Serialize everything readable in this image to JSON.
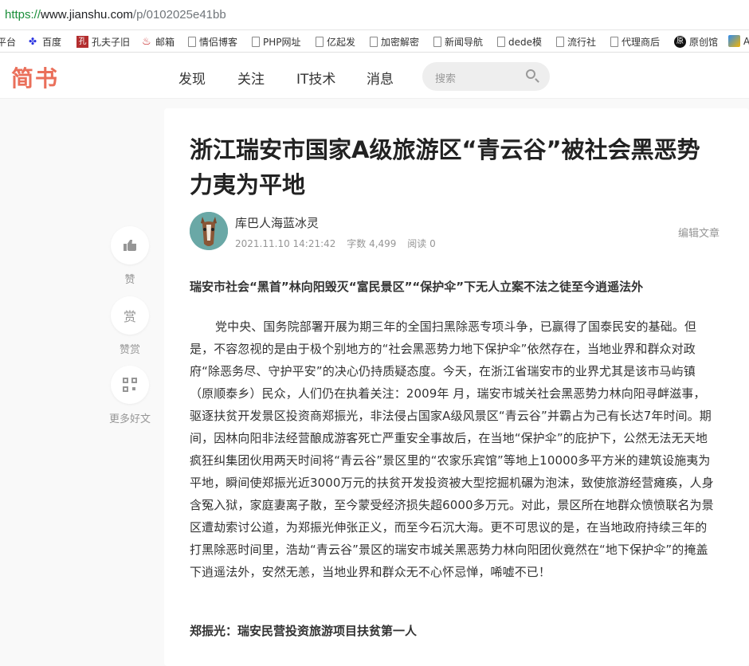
{
  "browser": {
    "url_scheme": "https://",
    "url_host": "www.jianshu.com",
    "url_path": "/p/0102025e41bb"
  },
  "bookmarks": [
    {
      "label": "平台",
      "icon": "doc-icon"
    },
    {
      "label": "百度",
      "icon": "baidu-icon"
    },
    {
      "label": "孔夫子旧",
      "icon": "kongfuzi-icon"
    },
    {
      "label": "邮箱",
      "icon": "mail-icon"
    },
    {
      "label": "情侣博客",
      "icon": "doc-icon"
    },
    {
      "label": "PHP网址",
      "icon": "doc-icon"
    },
    {
      "label": "亿起发",
      "icon": "doc-icon"
    },
    {
      "label": "加密解密",
      "icon": "doc-icon"
    },
    {
      "label": "新闻导航",
      "icon": "doc-icon"
    },
    {
      "label": "dede模",
      "icon": "doc-icon"
    },
    {
      "label": "流行社",
      "icon": "doc-icon"
    },
    {
      "label": "代理商后",
      "icon": "doc-icon"
    },
    {
      "label": "原创馆",
      "icon": "yuanchuang-icon"
    },
    {
      "label": "A",
      "icon": "app-icon"
    }
  ],
  "header": {
    "logo": "简书",
    "nav": [
      "发现",
      "关注",
      "IT技术",
      "消息"
    ],
    "search_placeholder": "搜索"
  },
  "sidebar": {
    "like_label": "赞",
    "reward_icon_text": "赏",
    "reward_label": "赞赏",
    "more_label": "更多好文"
  },
  "article": {
    "title": "浙江瑞安市国家A级旅游区“青云谷”被社会黑恶势力夷为平地",
    "author": "库巴人海蓝冰灵",
    "date": "2021.11.10 14:21:42",
    "word_count": "字数 4,499",
    "read_count": "阅读 0",
    "edit_label": "编辑文章",
    "lead": "瑞安市社会“黑首”林向阳毁灭“富民景区”“保护伞”下无人立案不法之徒至今逍遥法外",
    "paragraph": "党中央、国务院部署开展为期三年的全国扫黑除恶专项斗争，已赢得了国泰民安的基础。但是，不容忽视的是由于极个别地方的“社会黑恶势力地下保护伞”依然存在，当地业界和群众对政府“除恶务尽、守护平安”的决心仍持质疑态度。今天，在浙江省瑞安市的业界尤其是该市马屿镇（原顺泰乡）民众，人们仍在执着关注：2009年 月，瑞安市城关社会黑恶势力林向阳寻衅滋事，驱逐扶贫开发景区投资商郑振光，非法侵占国家A级风景区“青云谷”并霸占为己有长达7年时间。期间，因林向阳非法经营酿成游客死亡严重安全事故后，在当地“保护伞”的庇护下，公然无法无天地疯狂纠集团伙用两天时间将“青云谷”景区里的“农家乐宾馆”等地上10000多平方米的建筑设施夷为平地，瞬间使郑振光近3000万元的扶贫开发投资被大型挖掘机碾为泡沫，致使旅游经营瘫痪，人身含冤入狱，家庭妻离子散，至今蒙受经济损失超6000多万元。对此，景区所在地群众愤愤联名为景区遭劫索讨公道，为郑振光伸张正义，而至今石沉大海。更不可思议的是，在当地政府持续三年的打黑除恶时间里，浩劫“青云谷”景区的瑞安市城关黑恶势力林向阳团伙竟然在“地下保护伞”的掩盖下逍遥法外，安然无恙，当地业界和群众无不心怀忌惮，唏嘘不已！",
    "subheading": "郑振光：瑞安民营投资旅游项目扶贫第一人"
  }
}
